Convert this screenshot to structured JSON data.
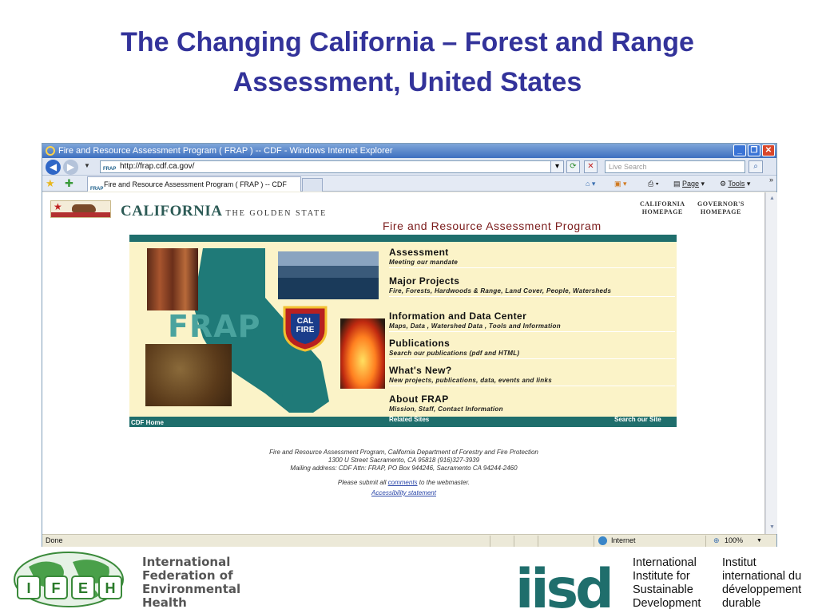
{
  "slide": {
    "title_line1": "The Changing California – Forest and Range",
    "title_line2": "Assessment, United States",
    "title_color": "#33339a"
  },
  "browser": {
    "window_title": "Fire and Resource Assessment Program ( FRAP ) -- CDF - Windows Internet Explorer",
    "address": "http://frap.cdf.ca.gov/",
    "favicon_text": "FRAP",
    "search_placeholder": "Live Search",
    "tab_label": "Fire and Resource Assessment Program ( FRAP ) -- CDF",
    "page_menu": "Page",
    "tools_menu": "Tools",
    "status_text": "Done",
    "zone_text": "Internet",
    "zoom_text": "100%"
  },
  "site": {
    "ca_title": "CALIFORNIA",
    "ca_tagline": "THE GOLDEN STATE",
    "link_ca_home_1": "CALIFORNIA",
    "link_ca_home_2": "HOMEPAGE",
    "link_gov_home_1": "GOVERNOR'S",
    "link_gov_home_2": "HOMEPAGE",
    "program_title": "Fire and Resource Assessment Program",
    "frap_logo": "FRAP",
    "calfire_1": "CAL",
    "calfire_2": "FIRE",
    "menu": [
      {
        "head": "Assessment",
        "sub": "Meeting our mandate"
      },
      {
        "head": "Major Projects",
        "sub": "Fire, Forests, Hardwoods & Range, Land Cover, People, Watersheds"
      },
      {
        "head": "Information and Data Center",
        "sub": "Maps, Data , Watershed Data , Tools and Information"
      },
      {
        "head": "Publications",
        "sub": "Search our publications (pdf and HTML)"
      },
      {
        "head": "What's New?",
        "sub": "New projects, publications, data, events and links"
      },
      {
        "head": "About FRAP",
        "sub": "Mission, Staff, Contact Information"
      }
    ],
    "bottom_links": {
      "cdf_home": "CDF Home",
      "related_sites": "Related Sites",
      "search_site": "Search our Site"
    },
    "footer": {
      "line1": "Fire and Resource Assessment Program, California Department of Forestry and Fire Protection",
      "line2": "1300 U Street Sacramento, CA 95818 (916)327-3939",
      "line3": "Mailing address: CDF Attn: FRAP, PO Box 944246, Sacramento CA 94244-2460",
      "submit_pre": "Please submit all",
      "submit_link": "comments",
      "submit_post": "to the webmaster.",
      "accessibility": "Accessibility statement"
    },
    "colors": {
      "teal": "#1f6e6c",
      "cream": "#fbf3c8",
      "program_title": "#7a1a1a"
    }
  },
  "logos": {
    "ifeh_letters": [
      "I",
      "F",
      "E",
      "H"
    ],
    "ifeh_line1": "International",
    "ifeh_line2": "Federation of",
    "ifeh_line3": "Environmental",
    "ifeh_line4": "Health",
    "iisd_mark": "iisd",
    "iisd_en_1": "International",
    "iisd_en_2": "Institute for",
    "iisd_en_3": "Sustainable",
    "iisd_en_4": "Development",
    "iisd_fr_1": "Institut",
    "iisd_fr_2": "international du",
    "iisd_fr_3": "développement",
    "iisd_fr_4": "durable"
  }
}
